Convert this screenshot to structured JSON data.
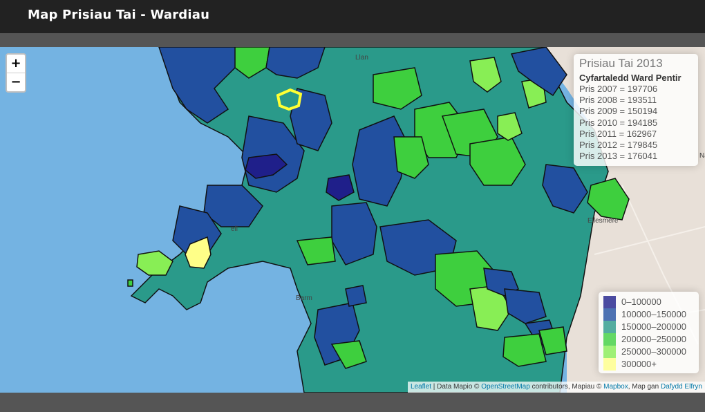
{
  "header": {
    "title": "Map Prisiau Tai - Wardiau"
  },
  "zoom": {
    "in_label": "+",
    "out_label": "−"
  },
  "info": {
    "title": "Prisiau Tai 2013",
    "subtitle": "Cyfartaledd Ward Pentir",
    "rows": [
      "Pris 2007 = 197706",
      "Pris 2008 = 193511",
      "Pris 2009 = 150194",
      "Pris 2010 = 194185",
      "Pris 2011 = 162967",
      "Pris 2012 = 179845",
      "Pris 2013 = 176041"
    ]
  },
  "legend": {
    "items": [
      {
        "label": "0–100000",
        "color": "#1f1f8a"
      },
      {
        "label": "100000–150000",
        "color": "#2250a0"
      },
      {
        "label": "150000–200000",
        "color": "#2a9a8a"
      },
      {
        "label": "200000–250000",
        "color": "#3ecf3e"
      },
      {
        "label": "250000–300000",
        "color": "#88ee55"
      },
      {
        "label": "300000+",
        "color": "#ffff88"
      }
    ]
  },
  "map": {
    "sea_color": "#74b3e2",
    "land_color": "#e8e0d8",
    "highlight_color": "#ffff33",
    "place_labels": [
      "Ellesmere",
      "Nantw",
      "Llan",
      "Barm",
      "ell"
    ]
  },
  "attribution": {
    "leaflet": "Leaflet",
    "sep1": " | Data Mapio © ",
    "osm": "OpenStreetMap",
    "mid": " contributors, Mapiau © ",
    "mapbox": "Mapbox",
    "mid2": ", Map gan ",
    "author": "Dafydd Elfryn"
  }
}
